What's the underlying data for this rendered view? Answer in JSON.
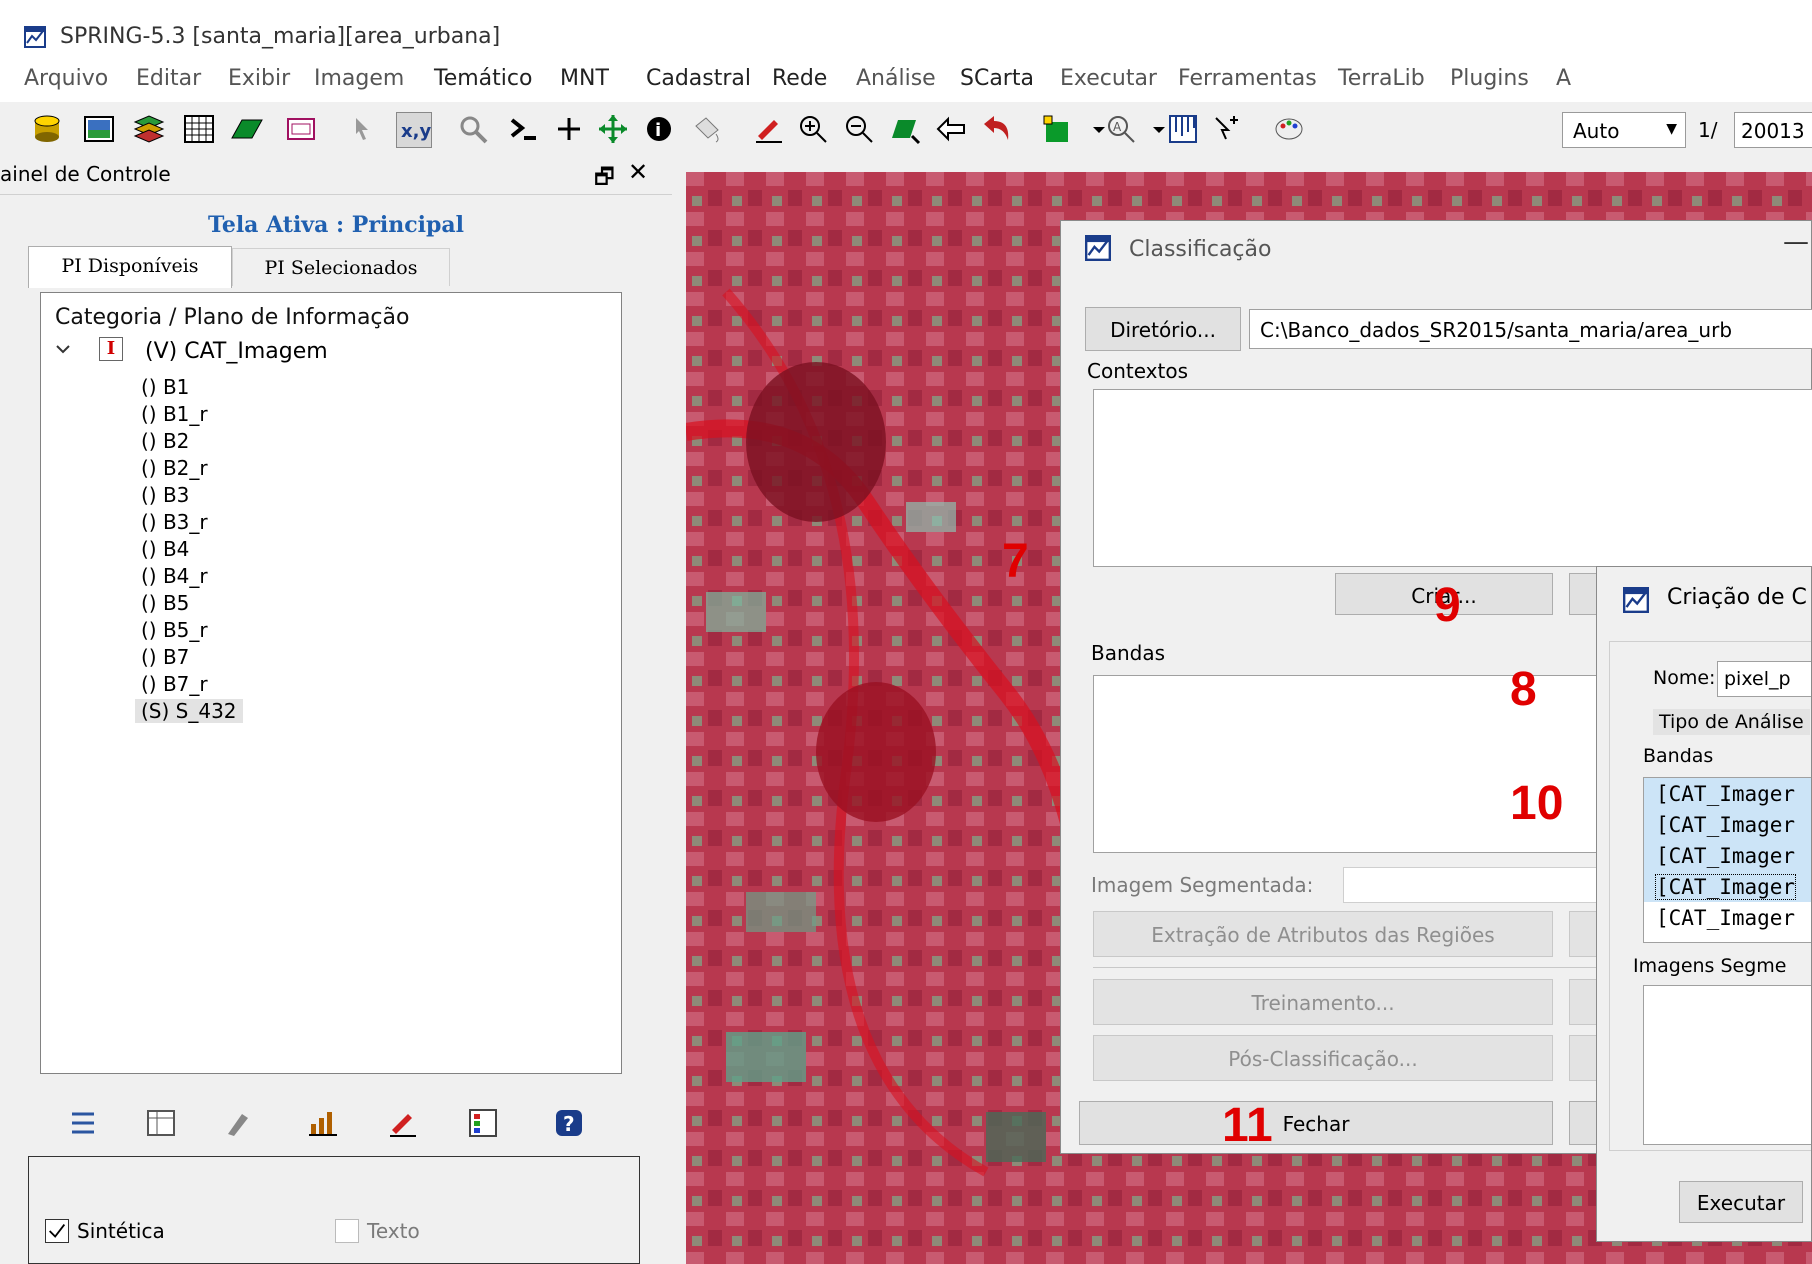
{
  "window": {
    "title": "SPRING-5.3 [santa_maria][area_urbana]"
  },
  "menu": [
    "Arquivo",
    "Editar",
    "Exibir",
    "Imagem",
    "Temático",
    "MNT",
    "Cadastral",
    "Rede",
    "Análise",
    "SCarta",
    "Executar",
    "Ferramentas",
    "TerraLib",
    "Plugins",
    "A"
  ],
  "toolbar": {
    "icons": [
      "database-icon",
      "image-icon",
      "layers-icon",
      "grid-icon",
      "plane-icon",
      "window-icon",
      "cursor-icon",
      "coord-icon",
      "search-icon",
      "step-icon",
      "plus-icon",
      "pan-icon",
      "info-icon",
      "paint-icon",
      "pencil-icon",
      "zoom-in-icon",
      "zoom-out-icon",
      "zoom-area-icon",
      "back-icon",
      "undo-icon",
      "green-box-icon",
      "zoom-level-icon",
      "ruler-icon",
      "pointer-plus-icon",
      "palette-icon"
    ],
    "zoom_value": "Auto",
    "scale_prefix": "1/",
    "scale_value": "20013"
  },
  "panel": {
    "title": "ainel de Controle",
    "tela_ativa": "Tela Ativa : Principal",
    "tabs": [
      "PI Disponíveis",
      "PI Selecionados"
    ],
    "tree_header": "Categoria / Plano de Informação",
    "root_label": "(V) CAT_Imagem",
    "root_icon_letter": "I",
    "items": [
      "() B1",
      "() B1_r",
      "() B2",
      "() B2_r",
      "() B3",
      "() B3_r",
      "() B4",
      "() B4_r",
      "() B5",
      "() B5_r",
      "() B7",
      "() B7_r",
      "(S) S_432"
    ],
    "options": {
      "sintetica": "Sintética",
      "texto": "Texto"
    }
  },
  "dialog_classificacao": {
    "title": "Classificação",
    "minimize": "—",
    "diretorio_button": "Diretório...",
    "diretorio_value": "C:\\Banco_dados_SR2015/santa_maria/area_urb",
    "contextos_label": "Contextos",
    "criar_button": "Criar...",
    "bandas_label": "Bandas",
    "imagem_segmentada_label": "Imagem Segmentada:",
    "extracao_button": "Extração de Atributos das Regiões",
    "treinamento_button": "Treinamento...",
    "pos_button": "Pós-Classificação...",
    "fechar_button": "Fechar"
  },
  "dialog_criacao": {
    "title": "Criação de C",
    "nome_label": "Nome:",
    "nome_value": "pixel_p",
    "tipo_label": "Tipo de Análise",
    "bandas_label": "Bandas",
    "bandas": [
      "[CAT_Imager",
      "[CAT_Imager",
      "[CAT_Imager",
      "[CAT_Imager",
      "[CAT_Imager"
    ],
    "imagens_label": "Imagens Segme",
    "executar_button": "Executar"
  },
  "annotations": [
    "7",
    "8",
    "9",
    "10",
    "11"
  ],
  "colors": {
    "link_blue": "#2060b0",
    "annotation_red": "#e00000",
    "imagery_red": "#b0304a"
  }
}
